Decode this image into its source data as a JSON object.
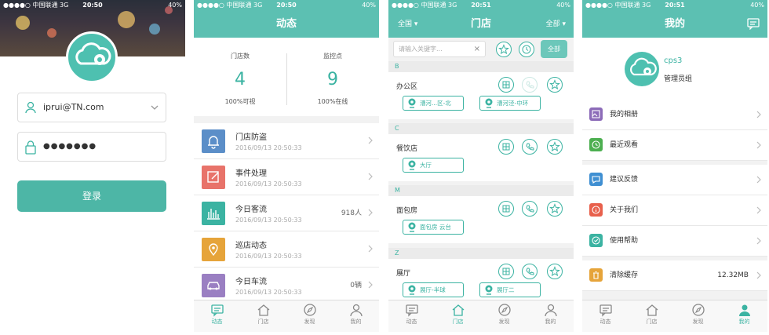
{
  "screen1": {
    "status": {
      "carrier": "●●●●○ 中国联通 3G",
      "time": "20:50",
      "battery": "40%"
    },
    "username": "iprui@TN.com",
    "password": "●●●●●●●",
    "login_label": "登录"
  },
  "screen2": {
    "status": {
      "carrier": "●●●●○ 中国联通 3G",
      "time": "20:50",
      "battery": "40%"
    },
    "title": "动态",
    "stats": [
      {
        "label": "门店数",
        "value": "4",
        "sub": "100%可视"
      },
      {
        "label": "监控点",
        "value": "9",
        "sub": "100%在线"
      }
    ],
    "feed": [
      {
        "title": "门店防盗",
        "time": "2016/09/13 20:50:33",
        "value": "",
        "color": "#5b8ec8",
        "icon": "bell-icon"
      },
      {
        "title": "事件处理",
        "time": "2016/09/13 20:50:33",
        "value": "",
        "color": "#e8736a",
        "icon": "edit-icon"
      },
      {
        "title": "今日客流",
        "time": "2016/09/13 20:50:33",
        "value": "918人",
        "color": "#3bb3a2",
        "icon": "bar-chart-icon"
      },
      {
        "title": "巡店动态",
        "time": "2016/09/13 20:50:33",
        "value": "",
        "color": "#e6a43a",
        "icon": "map-pin-icon"
      },
      {
        "title": "今日车流",
        "time": "2016/09/13 20:50:33",
        "value": "0辆",
        "color": "#9a7fc2",
        "icon": "car-icon"
      }
    ],
    "tabs": [
      "动态",
      "门店",
      "发现",
      "我的"
    ]
  },
  "screen3": {
    "status": {
      "carrier": "●●●●○ 中国联通 3G",
      "time": "20:51",
      "battery": "40%"
    },
    "title": "门店",
    "left_filter": "全国 ▾",
    "right_filter": "全部 ▾",
    "search_placeholder": "请输入关键字...",
    "all_label": "全部",
    "sections": [
      {
        "letter": "B",
        "store": "办公区",
        "cams": [
          "漕河...区-北",
          "漕河泾-中环"
        ]
      },
      {
        "letter": "C",
        "store": "餐饮店",
        "cams": [
          "大厅"
        ]
      },
      {
        "letter": "M",
        "store": "面包房",
        "cams": [
          "面包房 云台"
        ]
      },
      {
        "letter": "Z",
        "store": "展厅",
        "cams": [
          "展厅-半球",
          "展厅二"
        ]
      }
    ],
    "tabs": [
      "动态",
      "门店",
      "发现",
      "我的"
    ]
  },
  "screen4": {
    "status": {
      "carrier": "●●●●○ 中国联通 3G",
      "time": "20:51",
      "battery": "40%"
    },
    "title": "我的",
    "user_name": "cps3",
    "user_role": "管理员组",
    "menu": [
      {
        "label": "我的相册",
        "value": "",
        "color": "#8c6bb8",
        "icon": "album-icon"
      },
      {
        "label": "最近观看",
        "value": "",
        "color": "#4caf50",
        "icon": "clock-icon"
      },
      {
        "label": "建议反馈",
        "value": "",
        "color": "#3f8fd2",
        "icon": "feedback-icon"
      },
      {
        "label": "关于我们",
        "value": "",
        "color": "#e8604c",
        "icon": "info-icon"
      },
      {
        "label": "使用帮助",
        "value": "",
        "color": "#3bb3a2",
        "icon": "help-icon"
      },
      {
        "label": "清除缓存",
        "value": "12.32MB",
        "color": "#e6a43a",
        "icon": "trash-icon"
      }
    ],
    "tabs": [
      "动态",
      "门店",
      "发现",
      "我的"
    ]
  }
}
